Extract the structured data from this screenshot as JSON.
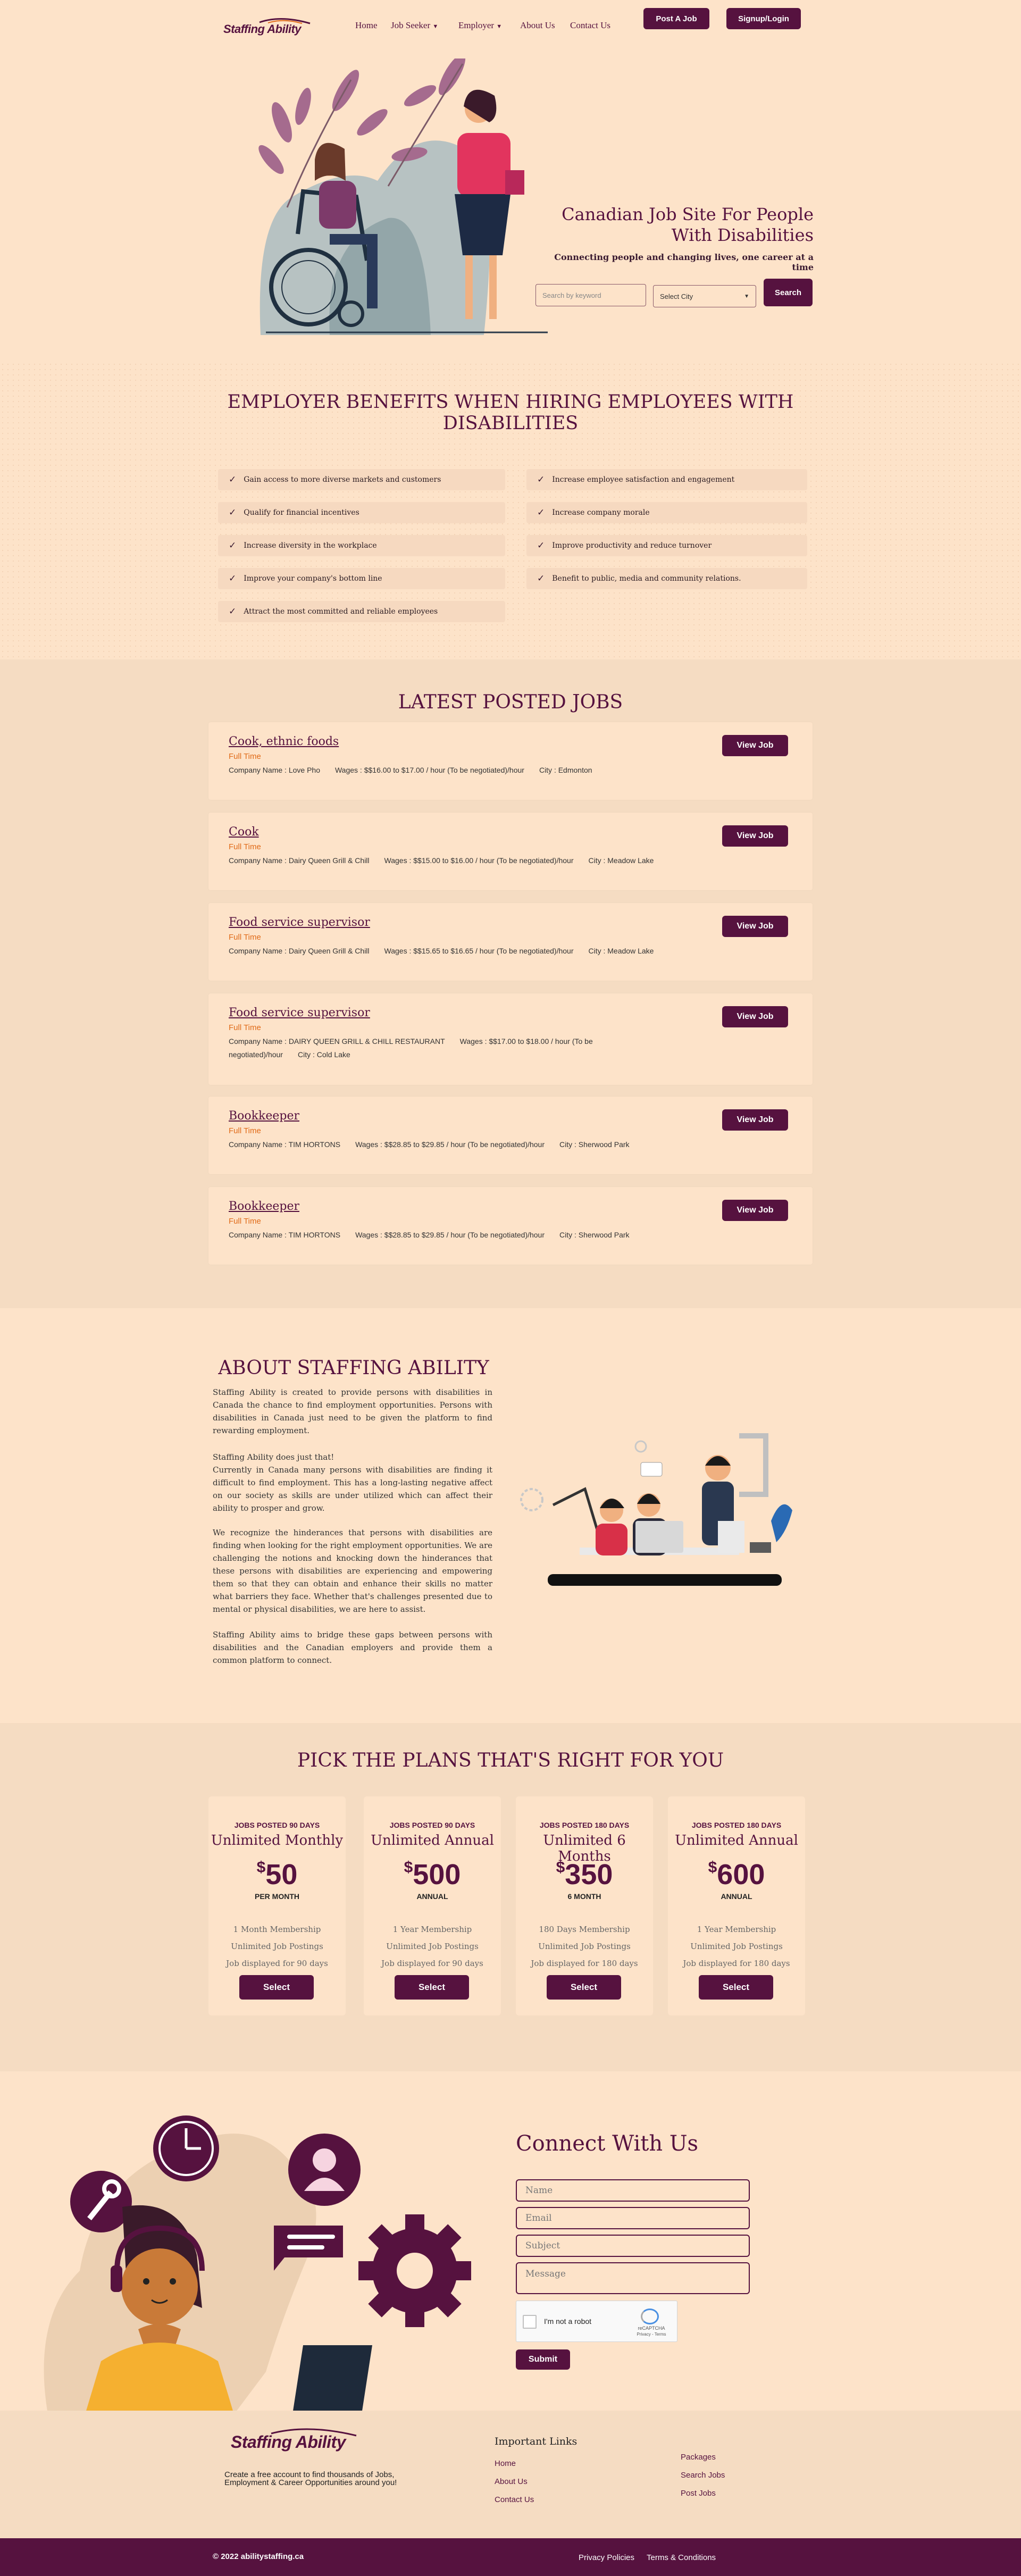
{
  "brand": {
    "name": "Staffing Ability"
  },
  "nav": {
    "home": "Home",
    "job_seeker": "Job Seeker",
    "employer": "Employer",
    "about": "About Us",
    "contact": "Contact Us",
    "post_job": "Post A Job",
    "signup": "Signup/Login"
  },
  "hero": {
    "title_line1": "Canadian Job Site For People",
    "title_line2": "With Disabilities",
    "subtitle": "Connecting people and changing lives, one career at a time",
    "keyword_placeholder": "Search by keyword",
    "city_select": "Select City",
    "search_button": "Search"
  },
  "benefits": {
    "title": "EMPLOYER BENEFITS WHEN HIRING EMPLOYEES WITH DISABILITIES",
    "left": [
      "Gain access to more diverse markets and customers",
      "Qualify for financial incentives",
      "Increase diversity in the workplace",
      "Improve your company's bottom line",
      "Attract the most committed and reliable employees"
    ],
    "right": [
      "Increase employee satisfaction and engagement",
      "Increase company morale",
      "Improve productivity and reduce turnover",
      "Benefit to public, media and community relations."
    ]
  },
  "jobs": {
    "title": "LATEST POSTED JOBS",
    "view_label": "View Job",
    "items": [
      {
        "title": "Cook, ethnic foods",
        "type": "Full Time",
        "company": "Company Name : Love Pho",
        "wages": "Wages : $$16.00 to $17.00 / hour (To be negotiated)/hour",
        "city": "City : Edmonton"
      },
      {
        "title": "Cook",
        "type": "Full Time",
        "company": "Company Name : Dairy Queen Grill & Chill",
        "wages": "Wages : $$15.00 to $16.00 / hour (To be negotiated)/hour",
        "city": "City : Meadow Lake"
      },
      {
        "title": "Food service supervisor",
        "type": "Full Time",
        "company": "Company Name : Dairy Queen Grill & Chill",
        "wages": "Wages : $$15.65 to $16.65 / hour (To be negotiated)/hour",
        "city": "City : Meadow Lake"
      },
      {
        "title": "Food service supervisor",
        "type": "Full Time",
        "company": "Company Name : DAIRY QUEEN GRILL & CHILL RESTAURANT",
        "wages": "Wages : $$17.00 to $18.00 / hour (To be negotiated)/hour",
        "city": "City : Cold Lake"
      },
      {
        "title": "Bookkeeper",
        "type": "Full Time",
        "company": "Company Name : TIM HORTONS",
        "wages": "Wages : $$28.85 to $29.85 / hour (To be negotiated)/hour",
        "city": "City : Sherwood Park"
      },
      {
        "title": "Bookkeeper",
        "type": "Full Time",
        "company": "Company Name : TIM HORTONS",
        "wages": "Wages : $$28.85 to $29.85 / hour (To be negotiated)/hour",
        "city": "City : Sherwood Park"
      }
    ]
  },
  "about": {
    "title": "ABOUT STAFFING ABILITY",
    "p1": "Staffing Ability is created to provide persons with disabilities in Canada the chance to find employment opportunities. Persons with disabilities in Canada just need to be given the platform to find rewarding employment.",
    "p2a": "Staffing Ability does just that!",
    "p2b": "Currently in Canada many persons with disabilities are finding it difficult to find employment. This has a long-lasting negative affect on our society as skills are under utilized which can affect their ability to prosper and grow.",
    "p3": "We recognize the hinderances that persons with disabilities are finding when looking for the right employment opportunities. We are challenging the notions and knocking down the hinderances that these persons with disabilities are experiencing and empowering them so that they can obtain and enhance their skills no matter what barriers they face. Whether that's challenges presented due to mental or physical disabilities, we are here to assist.",
    "p4": "Staffing Ability aims to bridge these gaps between persons with disabilities and the Canadian employers and provide them a common platform to connect."
  },
  "plans": {
    "title": "PICK THE PLANS THAT'S RIGHT FOR YOU",
    "select_label": "Select",
    "items": [
      {
        "tag": "JOBS POSTED 90 DAYS",
        "name": "Unlimited Monthly",
        "currency": "$",
        "price": "50",
        "period": "PER MONTH",
        "features": [
          "1 Month Membership",
          "Unlimited Job Postings",
          "Job displayed for 90 days"
        ]
      },
      {
        "tag": "JOBS POSTED 90 DAYS",
        "name": "Unlimited Annual",
        "currency": "$",
        "price": "500",
        "period": "ANNUAL",
        "features": [
          "1 Year Membership",
          "Unlimited Job Postings",
          "Job displayed for 90 days"
        ]
      },
      {
        "tag": "JOBS POSTED 180 DAYS",
        "name": "Unlimited 6 Months",
        "currency": "$",
        "price": "350",
        "period": "6 MONTH",
        "features": [
          "180 Days Membership",
          "Unlimited Job Postings",
          "Job displayed for 180 days"
        ]
      },
      {
        "tag": "JOBS POSTED 180 DAYS",
        "name": "Unlimited Annual",
        "currency": "$",
        "price": "600",
        "period": "ANNUAL",
        "features": [
          "1 Year Membership",
          "Unlimited Job Postings",
          "Job displayed for 180 days"
        ]
      }
    ]
  },
  "contact": {
    "title": "Connect With Us",
    "name": "Name",
    "email": "Email",
    "subject": "Subject",
    "message": "Message",
    "captcha": "I'm not a robot",
    "captcha_brand": "reCAPTCHA",
    "captcha_terms": "Privacy - Terms",
    "submit": "Submit"
  },
  "footer": {
    "tagline": "Create a free account to find thousands of Jobs, Employment & Career Opportunities around you!",
    "links_title": "Important Links",
    "links_col1": [
      "Home",
      "About Us",
      "Contact Us"
    ],
    "links_col2": [
      "Packages",
      "Search Jobs",
      "Post Jobs"
    ],
    "copyright": "© 2022 abilitystaffing.ca",
    "privacy": "Privacy Policies",
    "terms": "Terms & Conditions"
  },
  "colors": {
    "primary": "#56123f",
    "background": "#fde3c9",
    "section_alt": "#f5dcc2",
    "job_type": "#e06a18"
  }
}
